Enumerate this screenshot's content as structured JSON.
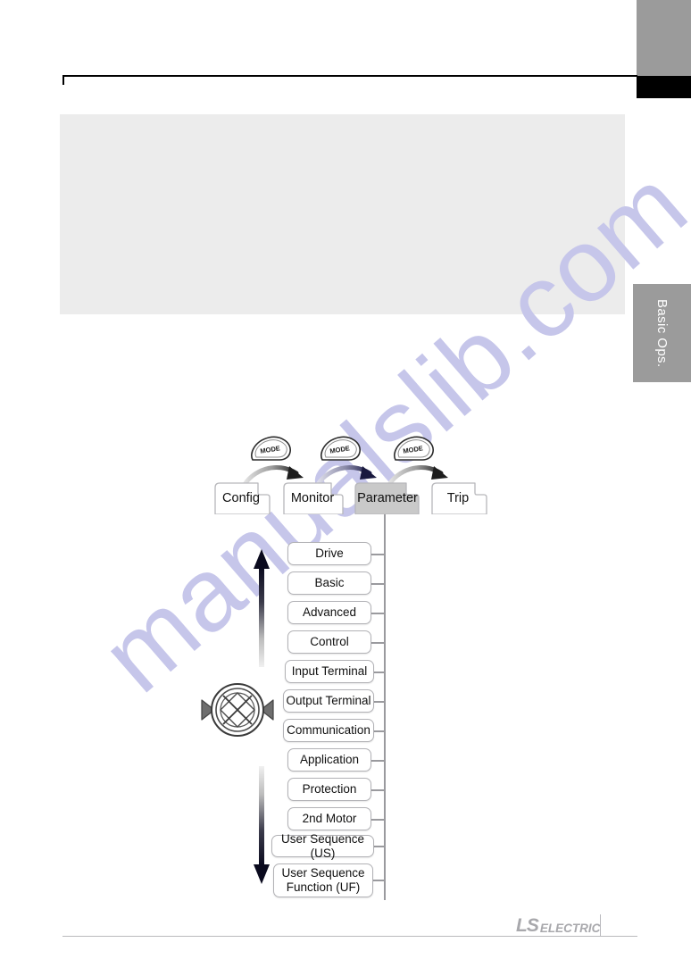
{
  "page": {
    "side_tab_label": "Basic Ops.",
    "watermark_text": "manualslib.com"
  },
  "footer": {
    "logo_primary": "LS",
    "logo_secondary": "ELECTRIC"
  },
  "diagram": {
    "mode_key_label": "MODE",
    "mode_keys": [
      {
        "label": "MODE"
      },
      {
        "label": "MODE"
      },
      {
        "label": "MODE"
      }
    ],
    "tabs": [
      {
        "label": "Config",
        "selected": false
      },
      {
        "label": "Monitor",
        "selected": false
      },
      {
        "label": "Parameter",
        "selected": true
      },
      {
        "label": "Trip",
        "selected": false
      }
    ],
    "parameter_groups": [
      {
        "label": "Drive"
      },
      {
        "label": "Basic"
      },
      {
        "label": "Advanced"
      },
      {
        "label": "Control"
      },
      {
        "label": "Input Terminal"
      },
      {
        "label": "Output Terminal"
      },
      {
        "label": "Communication"
      },
      {
        "label": "Application"
      },
      {
        "label": "Protection"
      },
      {
        "label": "2nd Motor"
      },
      {
        "label": "User Sequence (US)"
      },
      {
        "label": "User Sequence\nFunction (UF)"
      }
    ]
  },
  "colors": {
    "side_tab_bg": "#9b9b9b",
    "panel_bg": "#ececec",
    "watermark": "#c6c6ea",
    "selected_tab_bg": "#c9c9c9",
    "spine": "#9a9a9e",
    "logo": "#a8a8ac"
  }
}
